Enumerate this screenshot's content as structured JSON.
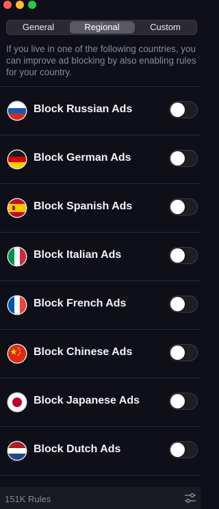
{
  "window": {
    "controls": [
      "close",
      "minimize",
      "maximize"
    ]
  },
  "tabs": {
    "items": [
      {
        "label": "General",
        "selected": false
      },
      {
        "label": "Regional",
        "selected": true
      },
      {
        "label": "Custom",
        "selected": false
      }
    ]
  },
  "description": "If you live in one of the following countries, you can improve ad blocking by also enabling rules for your country.",
  "filters": [
    {
      "label": "Block Russian Ads",
      "flag": "russia-flag-icon",
      "enabled": false
    },
    {
      "label": "Block German Ads",
      "flag": "germany-flag-icon",
      "enabled": false
    },
    {
      "label": "Block Spanish Ads",
      "flag": "spain-flag-icon",
      "enabled": false
    },
    {
      "label": "Block Italian Ads",
      "flag": "italy-flag-icon",
      "enabled": false
    },
    {
      "label": "Block French Ads",
      "flag": "france-flag-icon",
      "enabled": false
    },
    {
      "label": "Block Chinese Ads",
      "flag": "china-flag-icon",
      "enabled": false
    },
    {
      "label": "Block Japanese Ads",
      "flag": "japan-flag-icon",
      "enabled": false
    },
    {
      "label": "Block Dutch Ads",
      "flag": "netherlands-flag-icon",
      "enabled": false
    }
  ],
  "footer": {
    "rules_count": "151K Rules",
    "settings_icon": "sliders-icon"
  },
  "colors": {
    "background": "#0f0f1a",
    "segment_selected": "#5a5a62",
    "description_text": "#8a8a93",
    "toggle_off_track": "#1d1d24",
    "footer_background": "#1a1a22"
  }
}
